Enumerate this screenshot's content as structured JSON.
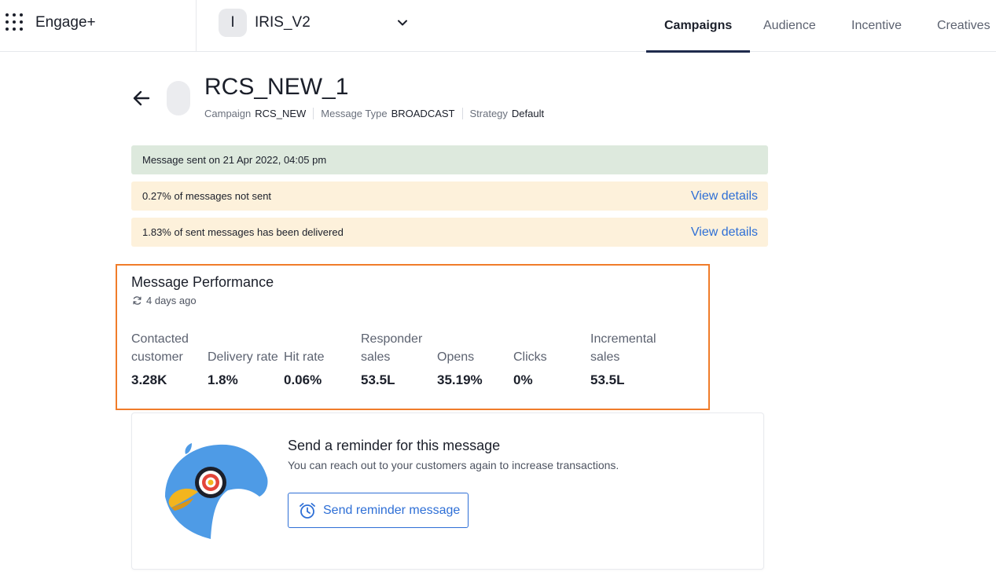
{
  "app": {
    "name": "Engage+"
  },
  "org": {
    "initial": "I",
    "name": "IRIS_V2"
  },
  "nav": {
    "tabs": [
      {
        "label": "Campaigns",
        "active": true
      },
      {
        "label": "Audience",
        "active": false
      },
      {
        "label": "Incentive",
        "active": false
      },
      {
        "label": "Creatives",
        "active": false
      }
    ]
  },
  "header": {
    "title": "RCS_NEW_1",
    "meta": [
      {
        "label": "Campaign",
        "value": "RCS_NEW"
      },
      {
        "label": "Message Type",
        "value": "BROADCAST"
      },
      {
        "label": "Strategy",
        "value": "Default"
      }
    ]
  },
  "banners": [
    {
      "text": "Message sent on 21 Apr 2022, 04:05 pm",
      "status": "success",
      "link": ""
    },
    {
      "text": "0.27% of messages not sent",
      "status": "warning",
      "link": "View details"
    },
    {
      "text": "1.83% of sent messages has been delivered",
      "status": "warning",
      "link": "View details"
    }
  ],
  "performance": {
    "title": "Message Performance",
    "updated": "4 days ago",
    "metrics": [
      {
        "label": "Contacted customer",
        "value": "3.28K"
      },
      {
        "label": "Delivery rate",
        "value": "1.8%"
      },
      {
        "label": "Hit rate",
        "value": "0.06%"
      },
      {
        "label": "Responder sales",
        "value": "53.5L"
      },
      {
        "label": "Opens",
        "value": "35.19%"
      },
      {
        "label": "Clicks",
        "value": "0%"
      },
      {
        "label": "Incremental sales",
        "value": "53.5L"
      }
    ]
  },
  "reminder": {
    "title": "Send a reminder for this message",
    "subtitle": "You can reach out to your customers again to increase transactions.",
    "button_label": "Send reminder message"
  },
  "colors": {
    "accent": "#2e6fd6",
    "highlight_border": "#f07c2a",
    "success_bg": "#dde9dd",
    "warning_bg": "#fdf1db",
    "nav_underline": "#1f2b4d"
  },
  "icons": {
    "apps": "apps-grid-icon",
    "org_chevron": "chevron-down-icon",
    "back": "arrow-left-icon",
    "refresh": "refresh-icon",
    "alarm": "alarm-clock-icon"
  }
}
